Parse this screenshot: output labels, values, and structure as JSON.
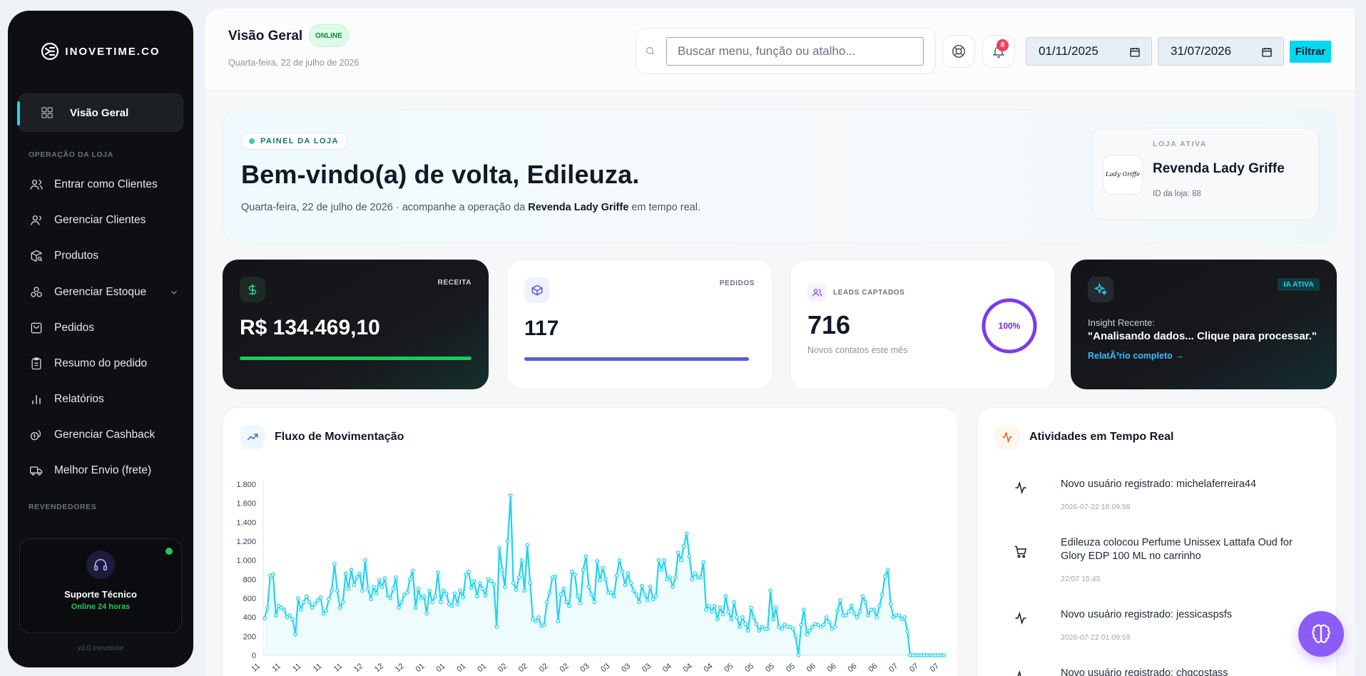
{
  "sidebar": {
    "brand": "INOVETIME.CO",
    "active_item": "Visão Geral",
    "sections": [
      "OPERAÇÃO DA LOJA",
      "REVENDEDORES"
    ],
    "items": [
      {
        "label": "Entrar como Clientes",
        "icon": "users-icon"
      },
      {
        "label": "Gerenciar Clientes",
        "icon": "user-icon"
      },
      {
        "label": "Produtos",
        "icon": "package-search-icon"
      },
      {
        "label": "Gerenciar Estoque",
        "icon": "boxes-icon"
      },
      {
        "label": "Pedidos",
        "icon": "shopping-bag-icon"
      },
      {
        "label": "Resumo do pedido",
        "icon": "clipboard-icon"
      },
      {
        "label": "Relatórios",
        "icon": "bar-chart-icon"
      },
      {
        "label": "Gerenciar Cashback",
        "icon": "coins-icon"
      },
      {
        "label": "Melhor Envio (frete)",
        "icon": "truck-icon"
      }
    ],
    "support": {
      "title": "Suporte Técnico",
      "status": "Online 24 horas"
    },
    "version": "v3.0 Inovetime"
  },
  "header": {
    "title": "Visão Geral",
    "status_badge": "ONLINE",
    "date": "Quarta-feira, 22 de julho de 2026",
    "search_placeholder": "Buscar menu, função ou atalho...",
    "notifications_count": "8",
    "date_from": "01/11/2025",
    "date_to": "31/07/2026",
    "filter_label": "Filtrar"
  },
  "welcome": {
    "badge": "PAINEL DA LOJA",
    "title": "Bem-vindo(a) de volta, Edileuza.",
    "subtitle_prefix": "Quarta-feira, 22 de julho de 2026 · acompanhe a operação da ",
    "subtitle_store": "Revenda Lady Griffe",
    "subtitle_suffix": " em tempo real.",
    "store_label": "LOJA ATIVA",
    "store_logo_text": "Lady Griffe",
    "store_name": "Revenda Lady Griffe",
    "store_id": "ID da loja: 88"
  },
  "kpis": {
    "revenue": {
      "tag": "RECEITA",
      "value": "R$ 134.469,10"
    },
    "orders": {
      "tag": "PEDIDOS",
      "value": "117"
    },
    "leads": {
      "tag": "LEADS CAPTADOS",
      "value": "716",
      "note": "Novos contatos este mês",
      "ring_label": "100%",
      "ring_fraction": 1.0
    },
    "insight": {
      "badge": "IA ATIVA",
      "label": "Insight Recente:",
      "text": "\"Analisando dados... Clique para processar.\"",
      "link": "RelatÃ³rio completo →"
    }
  },
  "colors": {
    "accent": "#22d3ee",
    "green": "#22c55e",
    "purple": "#7c3aed",
    "indigo": "#5b5bd6"
  },
  "chart_title": "Fluxo de Movimentação",
  "chart_data": {
    "type": "area",
    "title": "Fluxo de Movimentação",
    "xlabel": "",
    "ylabel": "",
    "ylim": [
      0,
      1800
    ],
    "yticks": [
      "0",
      "200",
      "400",
      "600",
      "800",
      "1.000",
      "1.200",
      "1.400",
      "1.600",
      "1.800"
    ],
    "grid": false,
    "color": "#22d3ee",
    "x_tick_labels": [
      "11",
      "11",
      "11",
      "11",
      "11",
      "12",
      "12",
      "12",
      "01",
      "01",
      "01",
      "01",
      "02",
      "02",
      "02",
      "02",
      "03",
      "03",
      "03",
      "03",
      "04",
      "04",
      "04",
      "05",
      "05",
      "05",
      "05",
      "06",
      "06",
      "06",
      "06",
      "07",
      "07",
      "07"
    ],
    "values": [
      390,
      500,
      840,
      850,
      420,
      520,
      500,
      480,
      400,
      420,
      380,
      220,
      600,
      480,
      560,
      620,
      560,
      500,
      540,
      580,
      610,
      440,
      470,
      590,
      680,
      960,
      680,
      500,
      560,
      860,
      700,
      900,
      740,
      820,
      860,
      680,
      1000,
      700,
      590,
      720,
      650,
      790,
      720,
      810,
      630,
      600,
      700,
      820,
      500,
      560,
      640,
      660,
      800,
      890,
      500,
      700,
      600,
      620,
      440,
      680,
      560,
      620,
      870,
      560,
      680,
      650,
      540,
      520,
      650,
      540,
      680,
      610,
      850,
      880,
      710,
      780,
      620,
      760,
      700,
      630,
      800,
      780,
      750,
      300,
      1130,
      900,
      720,
      1200,
      1680,
      760,
      690,
      820,
      1000,
      680,
      1160,
      760,
      380,
      360,
      400,
      310,
      320,
      560,
      660,
      820,
      830,
      360,
      640,
      700,
      560,
      520,
      880,
      850,
      620,
      550,
      900,
      1040,
      720,
      640,
      560,
      990,
      790,
      920,
      800,
      660,
      660,
      620,
      840,
      1000,
      880,
      740,
      860,
      760,
      680,
      640,
      560,
      730,
      640,
      580,
      720,
      590,
      620,
      1000,
      900,
      1000,
      800,
      820,
      720,
      820,
      1080,
      1000,
      1150,
      1280,
      1040,
      800,
      860,
      820,
      820,
      980,
      480,
      520,
      460,
      520,
      380,
      500,
      430,
      620,
      460,
      380,
      560,
      400,
      300,
      400,
      330,
      260,
      500,
      400,
      330,
      260,
      300,
      280,
      280,
      680,
      380,
      500,
      300,
      280,
      320,
      300,
      300,
      280,
      200,
      1,
      320,
      480,
      220,
      260,
      300,
      330,
      320,
      300,
      320,
      400,
      350,
      280,
      300,
      470,
      580,
      420,
      420,
      460,
      520,
      440,
      400,
      460,
      620,
      560,
      420,
      480,
      480,
      400,
      520,
      640,
      830,
      900,
      540,
      400,
      420,
      420,
      380,
      400,
      250,
      1,
      1,
      1,
      1,
      1,
      1,
      1,
      1,
      1,
      1,
      1,
      1,
      1
    ]
  },
  "activity": {
    "title": "Atividades em Tempo Real",
    "items": [
      {
        "icon": "activity-icon",
        "text": "Novo usuário registrado: michelaferreira44",
        "time": "2026-07-22 18:09:59"
      },
      {
        "icon": "shopping-cart-icon",
        "text": "Edileuza colocou Perfume Unissex Lattafa Oud for Glory EDP 100 ML no carrinho",
        "time": "22/07 15:45"
      },
      {
        "icon": "activity-icon",
        "text": "Novo usuário registrado: jessicaspsfs",
        "time": "2026-07-22 01:09:59"
      },
      {
        "icon": "activity-icon",
        "text": "Novo usuário registrado: chgcostass",
        "time": ""
      }
    ]
  }
}
